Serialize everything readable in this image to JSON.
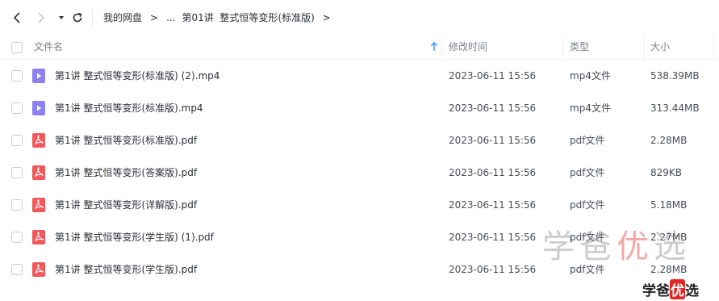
{
  "toolbar": {
    "back_icon": "chevron-left-icon",
    "forward_icon": "chevron-right-icon",
    "history_icon": "caret-down-icon",
    "refresh_icon": "refresh-icon"
  },
  "breadcrumb": {
    "root": "我的网盘",
    "separator": ">",
    "ellipsis": "...",
    "current": "第01讲  整式恒等变形(标准版)",
    "trailing_separator": ">"
  },
  "columns": {
    "name": "文件名",
    "modified": "修改时间",
    "type": "类型",
    "size": "大小"
  },
  "files": [
    {
      "name": "第1讲 整式恒等变形(标准版) (2).mp4",
      "modified": "2023-06-11 15:56",
      "type": "mp4文件",
      "size": "538.39MB",
      "icon": "video-file-icon"
    },
    {
      "name": "第1讲 整式恒等变形(标准版).mp4",
      "modified": "2023-06-11 15:56",
      "type": "mp4文件",
      "size": "313.44MB",
      "icon": "video-file-icon"
    },
    {
      "name": "第1讲 整式恒等变形(标准版).pdf",
      "modified": "2023-06-11 15:56",
      "type": "pdf文件",
      "size": "2.28MB",
      "icon": "pdf-file-icon"
    },
    {
      "name": "第1讲 整式恒等变形(答案版).pdf",
      "modified": "2023-06-11 15:56",
      "type": "pdf文件",
      "size": "829KB",
      "icon": "pdf-file-icon"
    },
    {
      "name": "第1讲 整式恒等变形(详解版).pdf",
      "modified": "2023-06-11 15:56",
      "type": "pdf文件",
      "size": "5.18MB",
      "icon": "pdf-file-icon"
    },
    {
      "name": "第1讲 整式恒等变形(学生版) (1).pdf",
      "modified": "2023-06-11 15:56",
      "type": "pdf文件",
      "size": "2.27MB",
      "icon": "pdf-file-icon"
    },
    {
      "name": "第1讲 整式恒等变形(学生版).pdf",
      "modified": "2023-06-11 15:56",
      "type": "pdf文件",
      "size": "2.28MB",
      "icon": "pdf-file-icon"
    }
  ],
  "watermark": {
    "prefix": "学爸",
    "highlight": "优",
    "suffix": "选"
  },
  "corner_logo": {
    "prefix": "学爸",
    "highlight": "优",
    "suffix": "选"
  },
  "colors": {
    "video_icon": "#8b83f0",
    "pdf_icon": "#f0585c",
    "sort_arrow": "#2f8cf5"
  }
}
